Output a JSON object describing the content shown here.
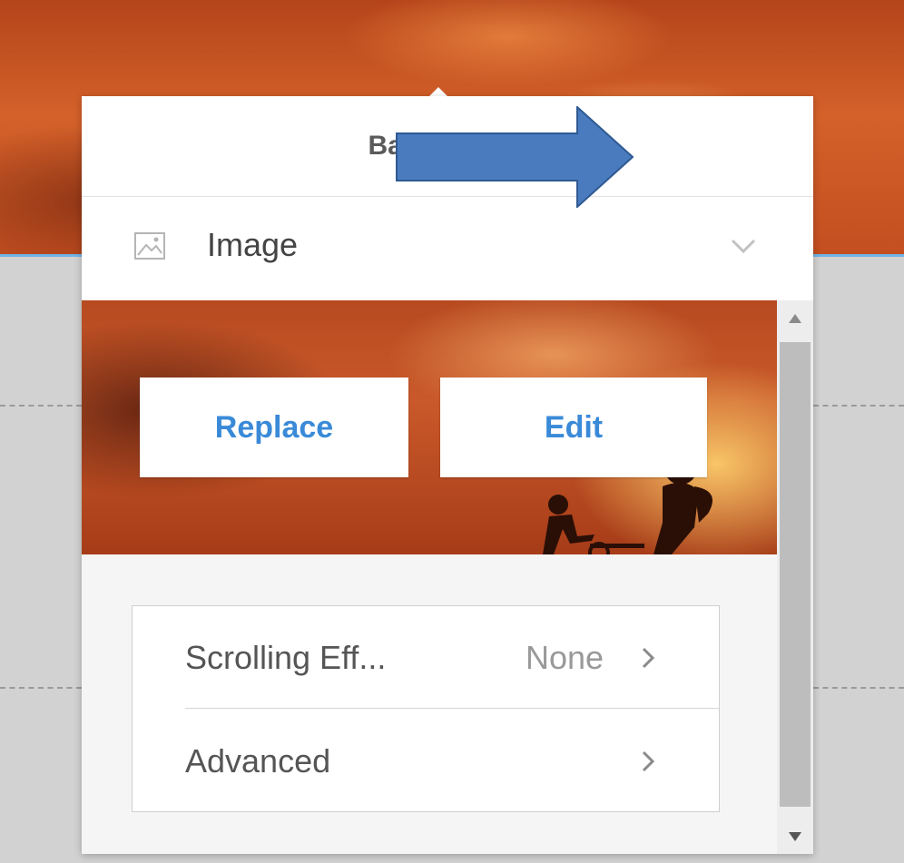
{
  "popup": {
    "title": "Background",
    "type": {
      "icon": "image-icon",
      "label": "Image",
      "dropdown_icon": "chevron-down-icon"
    }
  },
  "preview": {
    "replace_label": "Replace",
    "edit_label": "Edit"
  },
  "settings": [
    {
      "label": "Scrolling Eff...",
      "value": "None",
      "icon": "chevron-right-icon"
    },
    {
      "label": "Advanced",
      "value": "",
      "icon": "chevron-right-icon"
    }
  ],
  "scrollbar": {
    "up_icon": "scroll-up-arrow-icon",
    "down_icon": "scroll-down-arrow-icon"
  },
  "annotation": {
    "icon": "arrow-right-annotation",
    "color": "#4a7bbf"
  },
  "colors": {
    "accent": "#3a8ad8",
    "highlight_line": "#6fb2e6"
  }
}
